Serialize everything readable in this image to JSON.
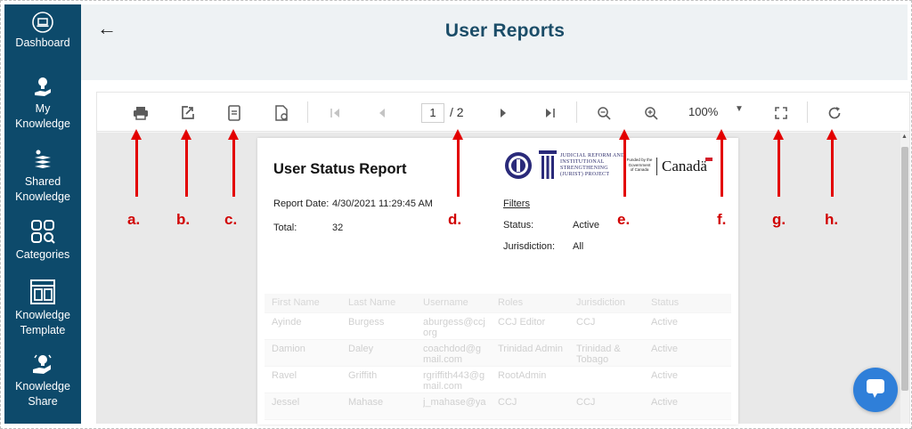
{
  "sidebar": {
    "items": [
      {
        "label": "Dashboard",
        "icon": "laptop-icon"
      },
      {
        "label": "My Knowledge",
        "icon": "lightbulb-hand-icon"
      },
      {
        "label": "Shared Knowledge",
        "icon": "shared-stack-icon"
      },
      {
        "label": "Categories",
        "icon": "grid-search-icon"
      },
      {
        "label": "Knowledge Template",
        "icon": "template-icon"
      },
      {
        "label": "Knowledge Share",
        "icon": "share-hand-icon"
      }
    ]
  },
  "header": {
    "back_icon": "arrow-left-icon",
    "back_glyph": "←",
    "title": "User Reports"
  },
  "toolbar": {
    "page_current": "1",
    "page_total": "/ 2",
    "zoom": "100%",
    "icons": [
      "print-icon",
      "export-icon",
      "document-icon",
      "page-settings-icon",
      "first-page-icon",
      "prev-page-icon",
      "next-page-icon",
      "last-page-icon",
      "zoom-out-icon",
      "zoom-in-icon",
      "fullscreen-icon",
      "refresh-icon"
    ]
  },
  "report": {
    "title": "User Status Report",
    "date_label": "Report Date:",
    "date_value": "4/30/2021 11:29:45 AM",
    "total_label": "Total:",
    "total_value": "32",
    "filters_label": "Filters",
    "status_label": "Status:",
    "status_value": "Active",
    "jurisdiction_label": "Jurisdiction:",
    "jurisdiction_value": "All",
    "logo_line1": "JUDICIAL REFORM AND",
    "logo_line2": "INSTITUTIONAL",
    "logo_line3": "STRENGTHENING",
    "logo_line4": "(JURIST) PROJECT",
    "funded_line1": "Funded by the",
    "funded_line2": "Government",
    "funded_line3": "of Canada",
    "canada_word": "Canadä"
  },
  "table": {
    "headers": [
      "First Name",
      "Last Name",
      "Username",
      "Roles",
      "Jurisdiction",
      "Status"
    ],
    "rows": [
      [
        "Ayinde",
        "Burgess",
        "aburgess@ccj org",
        "CCJ Editor",
        "CCJ",
        "Active"
      ],
      [
        "Damion",
        "Daley",
        "coachdod@g mail.com",
        "Trinidad Admin",
        "Trinidad & Tobago",
        "Active"
      ],
      [
        "Ravel",
        "Griffith",
        "rgriffith443@g mail.com",
        "RootAdmin",
        "",
        "Active"
      ],
      [
        "Jessel",
        "Mahase",
        "j_mahase@ya",
        "CCJ",
        "CCJ",
        "Active"
      ]
    ]
  },
  "annotations": [
    "a.",
    "b.",
    "c.",
    "d.",
    "e.",
    "f.",
    "g.",
    "h."
  ],
  "colors": {
    "sidebar": "#0d4a6b",
    "title": "#1b4d68",
    "annotation": "#e30000",
    "chat": "#2f7fd9"
  }
}
